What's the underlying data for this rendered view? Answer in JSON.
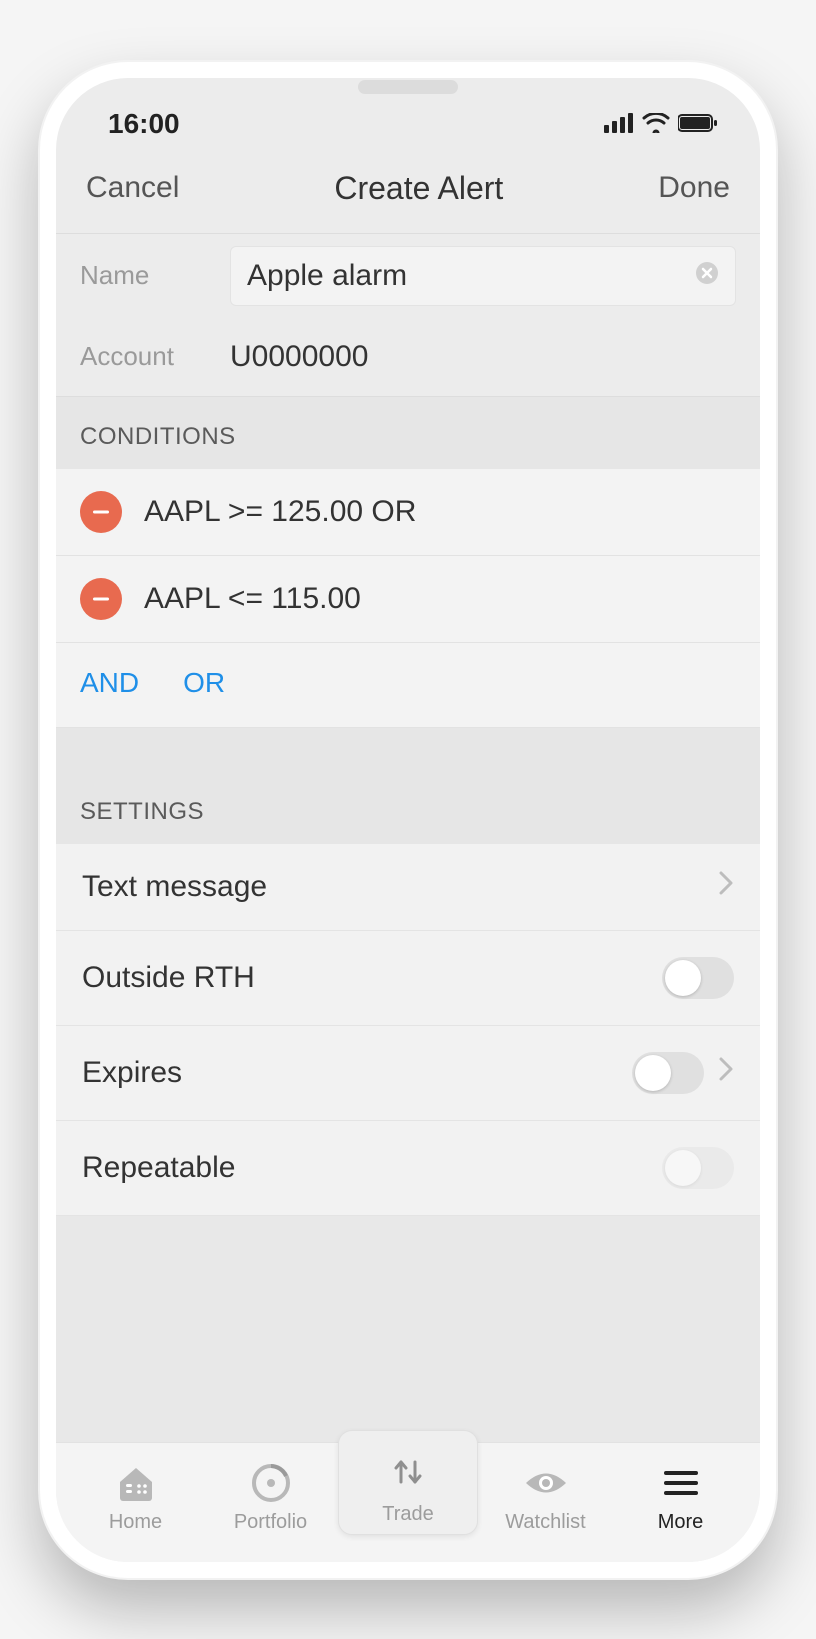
{
  "status": {
    "time": "16:00"
  },
  "header": {
    "cancel": "Cancel",
    "title": "Create Alert",
    "done": "Done"
  },
  "form": {
    "name_label": "Name",
    "name_value": "Apple alarm",
    "account_label": "Account",
    "account_value": "U0000000"
  },
  "conditions": {
    "header": "CONDITIONS",
    "items": [
      {
        "text": "AAPL >= 125.00 OR"
      },
      {
        "text": "AAPL <= 115.00"
      }
    ],
    "logic": {
      "and": "AND",
      "or": "OR"
    }
  },
  "settings": {
    "header": "SETTINGS",
    "text_message": "Text message",
    "outside_rth": "Outside RTH",
    "expires": "Expires",
    "repeatable": "Repeatable"
  },
  "tabs": {
    "home": "Home",
    "portfolio": "Portfolio",
    "trade": "Trade",
    "watchlist": "Watchlist",
    "more": "More"
  },
  "colors": {
    "accent_blue": "#1f8fe8",
    "delete_red": "#e86a4f"
  }
}
